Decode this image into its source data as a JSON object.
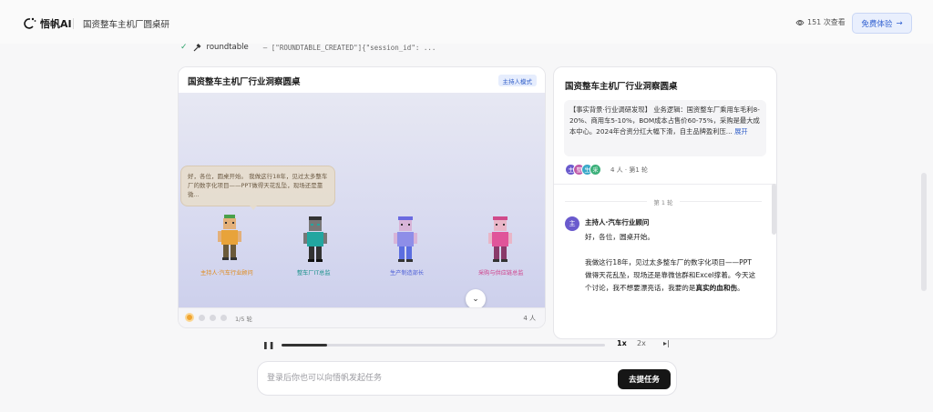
{
  "header": {
    "logo_text": "悟帆AI",
    "title": "国资整车主机厂圆桌研",
    "views": "151 次查看",
    "try_label": "免费体验",
    "try_arrow": "→"
  },
  "tool_call": {
    "name": "roundtable",
    "result": "— [\"ROUNDTABLE_CREATED\"]{\"session_id\": ..."
  },
  "stage": {
    "title": "国资整车主机厂行业洞察圆桌",
    "mode_badge": "主持人模式",
    "bubble_text": "好，各位，圆桌开始。 我做这行18年，见过太多整车厂的数字化项目——PPT做得天花乱坠，现场还是靠微...",
    "characters": [
      {
        "label": "主持人·汽车行业顾问",
        "color": "#e8a33a"
      },
      {
        "label": "整车厂IT总监",
        "color": "#22a6a0"
      },
      {
        "label": "生产制造部长",
        "color": "#5b6ee0"
      },
      {
        "label": "采购与供应链总监",
        "color": "#e0559a"
      }
    ],
    "round_indicator": "1/5 轮",
    "people_count": "4 人"
  },
  "info": {
    "title": "国资整车主机厂行业洞察圆桌",
    "summary": "【事实背景·行业调研发现】 业务逻辑：国资整车厂乘用车毛利8-20%、商用车5-10%，BOM成本占售价60-75%，采购是最大成本中心。2024年合资分红大幅下滑，自主品牌盈利压...",
    "expand": "展开",
    "avatars": [
      {
        "char": "主",
        "color": "#6a5acd"
      },
      {
        "char": "整",
        "color": "#c05aa8"
      },
      {
        "char": "生",
        "color": "#3aa8c8"
      },
      {
        "char": "采",
        "color": "#3cb07a"
      }
    ],
    "participants_text": "4 人 · 第1 轮",
    "round_label": "第 1 轮",
    "message": {
      "avatar": "主",
      "speaker": "主持人·汽车行业顾问",
      "p1": "好，各位，圆桌开始。",
      "p2_start": "我做这行18年，见过太多整车厂的数字化项目——PPT做得天花乱坠，现场还是靠微信群和Excel撑着。今天这个讨论，我不想要漂亮话，我要的是",
      "p2_bold": "真实的血和伤",
      "p2_end": "。"
    }
  },
  "playback": {
    "progress": 0.14,
    "speed_1x": "1x",
    "speed_2x": "2x"
  },
  "composer": {
    "placeholder": "登录后你也可以向悟帆发起任务",
    "send_label": "去提任务"
  }
}
